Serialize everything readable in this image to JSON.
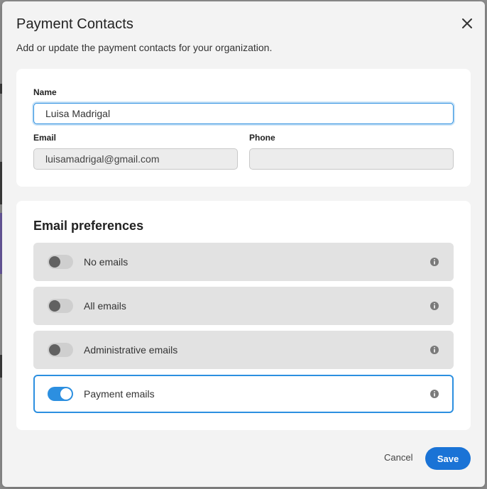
{
  "dialog": {
    "title": "Payment Contacts",
    "subtitle": "Add or update the payment contacts for your organization."
  },
  "contact": {
    "name_label": "Name",
    "name_value": "Luisa Madrigal",
    "email_label": "Email",
    "email_value": "luisamadrigal@gmail.com",
    "phone_label": "Phone",
    "phone_value": ""
  },
  "preferences": {
    "heading": "Email preferences",
    "items": [
      {
        "label": "No emails",
        "enabled": false
      },
      {
        "label": "All emails",
        "enabled": false
      },
      {
        "label": "Administrative emails",
        "enabled": false
      },
      {
        "label": "Payment emails",
        "enabled": true
      }
    ]
  },
  "footer": {
    "cancel_label": "Cancel",
    "save_label": "Save"
  },
  "colors": {
    "accent": "#2c8fe0",
    "save_button": "#1a73d6",
    "toggle_off_track": "#cfcfcf",
    "toggle_off_knob": "#616161",
    "row_background": "#e2e2e2"
  },
  "icons": {
    "close": "close-icon",
    "info": "info-icon"
  }
}
